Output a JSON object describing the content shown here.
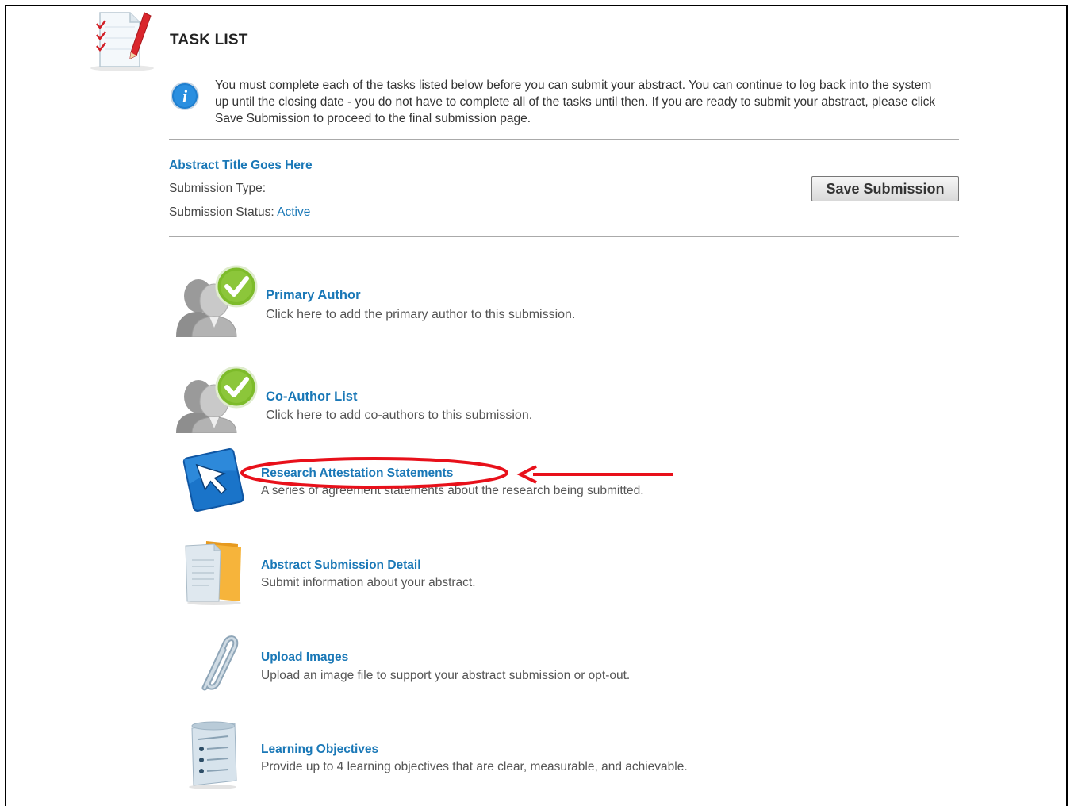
{
  "page": {
    "title": "TASK LIST",
    "info_text": "You must complete each of the tasks listed below before you can submit your abstract. You can continue to log back into the system up until the closing date - you do not have to complete all of the tasks until then. If you are ready to submit your abstract, please click Save Submission to proceed to the final submission page."
  },
  "submission": {
    "abstract_title": "Abstract Title Goes Here",
    "type_label": "Submission Type:",
    "status_label": "Submission Status:",
    "status_value": "Active",
    "save_button": "Save Submission"
  },
  "tasks": [
    {
      "name": "Primary Author",
      "description": "Click here to add the primary author to this submission.",
      "icon": "authors-check-icon"
    },
    {
      "name": "Co-Author List",
      "description": "Click here to add co-authors to this submission.",
      "icon": "authors-check-icon"
    },
    {
      "name": "Research Attestation Statements",
      "description": "A series of agreement statements about the research being submitted.",
      "icon": "cursor-arrow-icon"
    },
    {
      "name": "Abstract Submission Detail",
      "description": "Submit information about your abstract.",
      "icon": "documents-folder-icon"
    },
    {
      "name": "Upload Images",
      "description": "Upload an image file to support your abstract submission or opt-out.",
      "icon": "paperclip-icon"
    },
    {
      "name": "Learning Objectives",
      "description": "Provide up to 4 learning objectives that are clear, measurable, and achievable.",
      "icon": "scroll-list-icon"
    }
  ],
  "colors": {
    "link": "#1a78b7",
    "annotation": "#e8101a",
    "check_green": "#7dbb2a"
  }
}
